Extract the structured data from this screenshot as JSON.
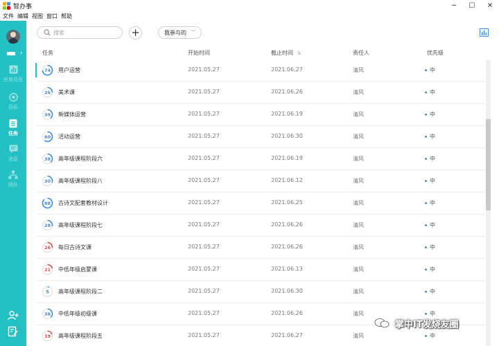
{
  "app": {
    "title": "智办事",
    "logo_colors": [
      "#f5a623",
      "#4a90e2",
      "#7ed321",
      "#d0021b"
    ]
  },
  "window_controls": {
    "minimize": "─",
    "maximize": "☐",
    "close": "✕"
  },
  "menu": [
    "文件",
    "编辑",
    "视图",
    "窗口",
    "帮助"
  ],
  "sidebar": {
    "bg": "#23c0c4",
    "nav": [
      {
        "label": "任务总览",
        "icon": "chart-icon",
        "active": false
      },
      {
        "label": "目标",
        "icon": "target-icon",
        "active": false
      },
      {
        "label": "任务",
        "icon": "task-list-icon",
        "active": true
      },
      {
        "label": "消息",
        "icon": "message-icon",
        "active": false
      },
      {
        "label": "团队",
        "icon": "team-icon",
        "active": false
      }
    ]
  },
  "toolbar": {
    "search_placeholder": "搜索",
    "add_label": "+",
    "filter_label": "我参与的"
  },
  "table": {
    "headers": {
      "task": "任务",
      "start": "开始时间",
      "end": "截止时间",
      "owner": "责任人",
      "priority": "优先级"
    },
    "rows": [
      {
        "progress": 74,
        "name": "用户运营",
        "start": "2021.05.27",
        "end": "2021.06.27",
        "owner": "清风",
        "priority": "中",
        "color": "#3a8ee6"
      },
      {
        "progress": 25,
        "name": "美术课",
        "start": "2021.05.27",
        "end": "2021.06.26",
        "owner": "清风",
        "priority": "中",
        "color": "#3a8ee6"
      },
      {
        "progress": 39,
        "name": "新媒体运营",
        "start": "2021.05.27",
        "end": "2021.06.19",
        "owner": "清风",
        "priority": "中",
        "color": "#3a8ee6"
      },
      {
        "progress": 60,
        "name": "活动运营",
        "start": "2021.05.27",
        "end": "2021.06.30",
        "owner": "清风",
        "priority": "中",
        "color": "#3a8ee6"
      },
      {
        "progress": 38,
        "name": "高年级课程阶段六",
        "start": "2021.05.27",
        "end": "2021.06.19",
        "owner": "清风",
        "priority": "中",
        "color": "#3a8ee6"
      },
      {
        "progress": 30,
        "name": "高年级课程阶段八",
        "start": "2021.05.27",
        "end": "2021.06.12",
        "owner": "清风",
        "priority": "中",
        "color": "#3a8ee6"
      },
      {
        "progress": 88,
        "name": "古诗文配套教材设计",
        "start": "2021.05.27",
        "end": "2021.06.25",
        "owner": "清风",
        "priority": "中",
        "color": "#3a8ee6"
      },
      {
        "progress": 28,
        "name": "高年级课程阶段七",
        "start": "2021.05.27",
        "end": "2021.06.26",
        "owner": "清风",
        "priority": "中",
        "color": "#3a8ee6"
      },
      {
        "progress": 26,
        "name": "每日古诗文课",
        "start": "2021.05.27",
        "end": "2021.06.26",
        "owner": "清风",
        "priority": "中",
        "color": "#e5474b"
      },
      {
        "progress": 21,
        "name": "中低年级启蒙课",
        "start": "2021.05.27",
        "end": "2021.06.13",
        "owner": "清风",
        "priority": "中",
        "color": "#e5474b"
      },
      {
        "progress": 5,
        "name": "高年级课程阶段二",
        "start": "2021.05.27",
        "end": "2021.06.30",
        "owner": "清风",
        "priority": "中",
        "color": "#3a8ee6"
      },
      {
        "progress": 38,
        "name": "中低年级初级课",
        "start": "2021.05.27",
        "end": "2021.06.26",
        "owner": "清风",
        "priority": "中",
        "color": "#3a8ee6"
      },
      {
        "progress": 19,
        "name": "高年级课程阶段五",
        "start": "2021.05.27",
        "end": "2021.06.27",
        "owner": "清风",
        "priority": "中",
        "color": "#e5474b"
      }
    ]
  },
  "watermark": "掌中IT发烧友圈"
}
